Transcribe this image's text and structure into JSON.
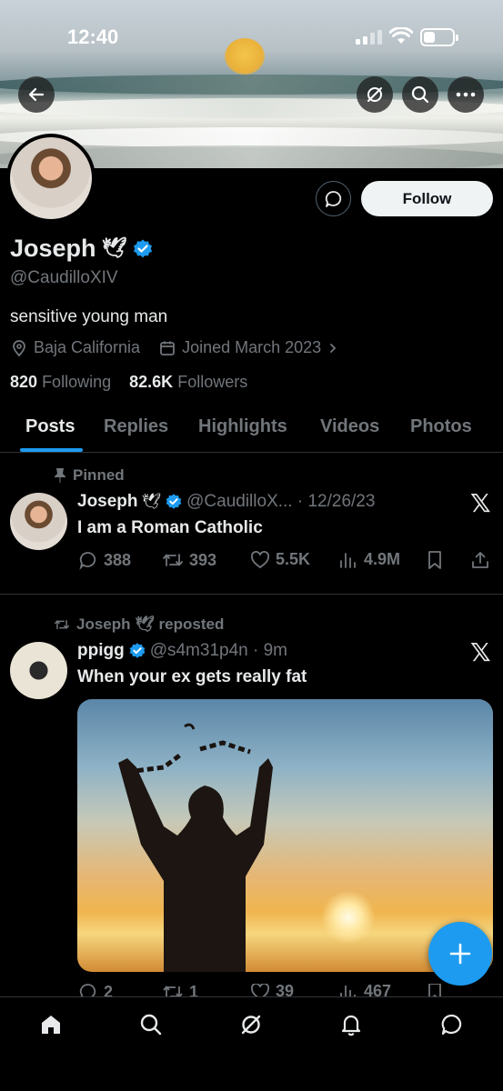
{
  "status_bar": {
    "time": "12:40"
  },
  "profile": {
    "name": "Joseph",
    "name_emoji": "🕊",
    "handle": "@CaudilloXIV",
    "bio": "sensitive young man",
    "location": "Baja California",
    "joined": "Joined March 2023",
    "following_count": "820",
    "following_label": "Following",
    "followers_count": "82.6K",
    "followers_label": "Followers",
    "follow_button": "Follow"
  },
  "tabs": [
    {
      "label": "Posts",
      "active": true
    },
    {
      "label": "Replies",
      "active": false
    },
    {
      "label": "Highlights",
      "active": false
    },
    {
      "label": "Videos",
      "active": false
    },
    {
      "label": "Photos",
      "active": false
    }
  ],
  "posts": [
    {
      "context_label": "Pinned",
      "name": "Joseph",
      "name_emoji": "🕊",
      "handle_date": "@CaudilloX... · 12/26/23",
      "text": "I am a Roman Catholic",
      "replies": "388",
      "reposts": "393",
      "likes": "5.5K",
      "views": "4.9M"
    },
    {
      "context_label": "Joseph 🕊 reposted",
      "name": "ppigg",
      "handle_date": "@s4m31p4n · 9m",
      "text": "When your ex gets really fat",
      "replies": "2",
      "reposts": "1",
      "likes": "39",
      "views": "467"
    }
  ],
  "colors": {
    "accent": "#1d9bf0",
    "background": "#000000",
    "text_primary": "#e7e9ea",
    "text_secondary": "#71767b",
    "divider": "#2f3336"
  },
  "icons": {
    "back": "arrow-left-icon",
    "grok": "grok-icon",
    "search": "search-icon",
    "more": "more-icon",
    "verified": "verified-badge-icon",
    "location": "location-pin-icon",
    "calendar": "calendar-icon",
    "pin": "pin-icon",
    "repost": "repost-icon"
  }
}
